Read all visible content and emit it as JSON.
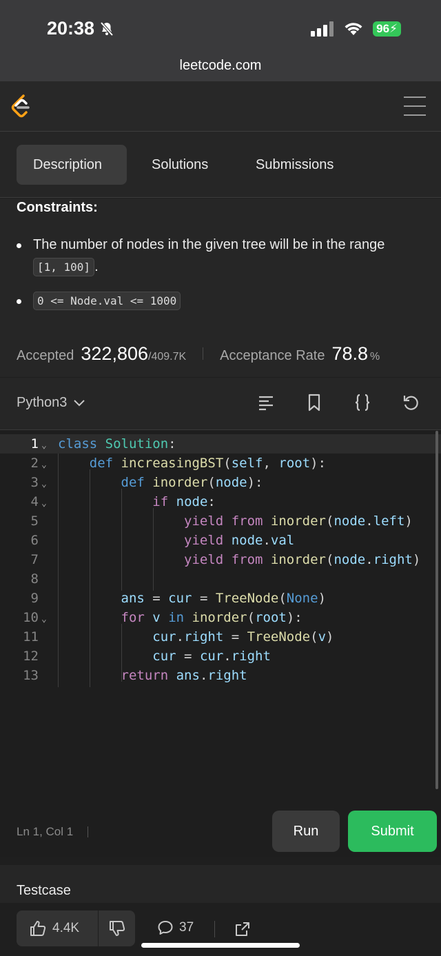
{
  "status": {
    "time": "20:38",
    "battery": "96"
  },
  "browser": {
    "url": "leetcode.com"
  },
  "tabs": [
    "Description",
    "Solutions",
    "Submissions"
  ],
  "description": {
    "heading": "Constraints:",
    "bullet1_text": "The number of nodes in the given tree will be in the range",
    "bullet1_code": "[1, 100]",
    "bullet1_end": ".",
    "bullet2_code": "0 <= Node.val <= 1000"
  },
  "stats": {
    "accepted_label": "Accepted",
    "accepted_value": "322,806",
    "accepted_total": "/409.7K",
    "rate_label": "Acceptance Rate",
    "rate_value": "78.8",
    "rate_unit": "%"
  },
  "editor": {
    "language": "Python3",
    "lines": [
      "1",
      "2",
      "3",
      "4",
      "5",
      "6",
      "7",
      "8",
      "9",
      "10",
      "11",
      "12",
      "13"
    ],
    "position": "Ln 1, Col 1"
  },
  "actions": {
    "run": "Run",
    "submit": "Submit"
  },
  "testcase_label": "Testcase",
  "footer": {
    "likes": "4.4K",
    "comments": "37"
  }
}
